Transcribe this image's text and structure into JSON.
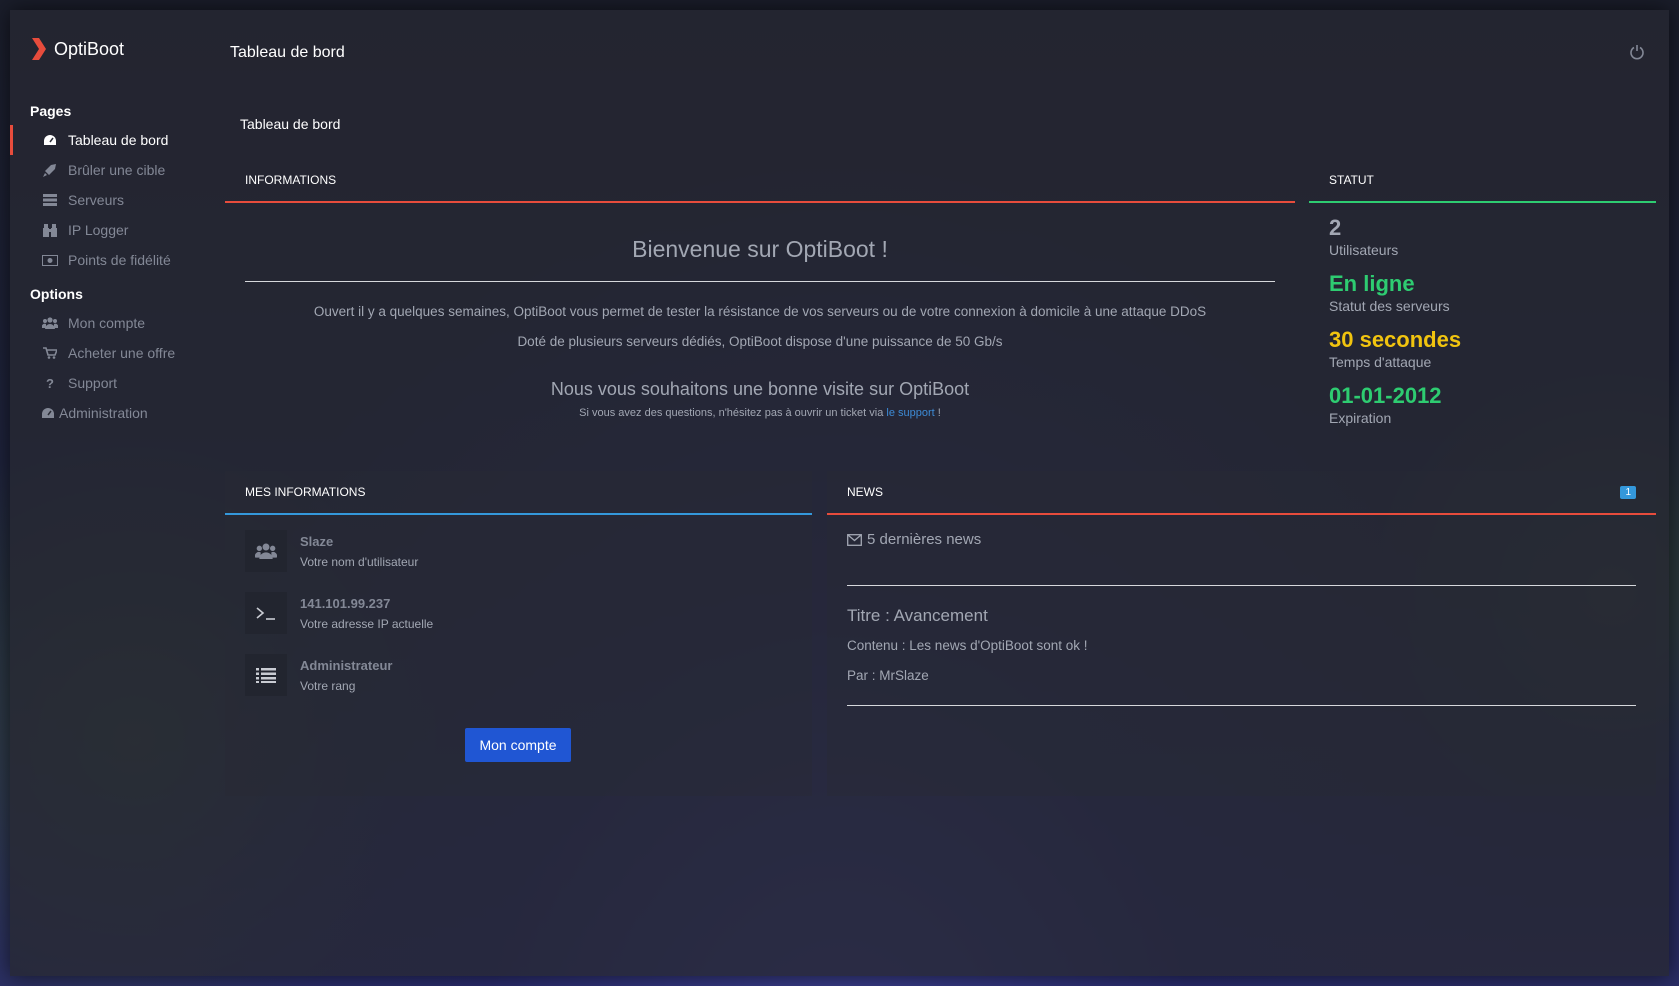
{
  "brand": {
    "name": "OptiBoot",
    "accent": "#e74c3c"
  },
  "topbar": {
    "title": "Tableau de bord",
    "power_icon": "power-icon"
  },
  "breadcrumb": "Tableau de bord",
  "sidebar": {
    "pages_heading": "Pages",
    "pages": [
      {
        "label": "Tableau de bord",
        "icon": "dashboard-icon",
        "active": true
      },
      {
        "label": "Brûler une cible",
        "icon": "rocket-icon"
      },
      {
        "label": "Serveurs",
        "icon": "server-icon"
      },
      {
        "label": "IP Logger",
        "icon": "binoculars-icon"
      },
      {
        "label": "Points de fidélité",
        "icon": "money-icon"
      }
    ],
    "options_heading": "Options",
    "options": [
      {
        "label": "Mon compte",
        "icon": "users-icon"
      },
      {
        "label": "Acheter une offre",
        "icon": "cart-icon"
      },
      {
        "label": "Support",
        "icon": "question-icon"
      },
      {
        "label": "Administration",
        "icon": "dashboard-icon"
      }
    ]
  },
  "informations": {
    "header": "INFORMATIONS",
    "welcome": "Bienvenue sur OptiBoot !",
    "line1": "Ouvert il y a quelques semaines, OptiBoot vous permet de tester la résistance de vos serveurs ou de votre connexion à domicile à une attaque DDoS",
    "line2": "Doté de plusieurs serveurs dédiés, OptiBoot dispose d'une puissance de 50 Gb/s",
    "wish": "Nous vous souhaitons une bonne visite sur OptiBoot",
    "help_prefix": "Si vous avez des questions, n'hésitez pas à ouvrir un ticket via ",
    "help_link": "le support",
    "help_suffix": " !"
  },
  "statut": {
    "header": "STATUT",
    "items": [
      {
        "value": "2",
        "label": "Utilisateurs",
        "color": "#a2a7b3"
      },
      {
        "value": "En ligne",
        "label": "Statut des serveurs",
        "color": "#2ecc71"
      },
      {
        "value": "30 secondes",
        "label": "Temps d'attaque",
        "color": "#f1c40f"
      },
      {
        "value": "01-01-2012",
        "label": "Expiration",
        "color": "#2ecc71"
      }
    ]
  },
  "mes_informations": {
    "header": "MES INFORMATIONS",
    "rows": [
      {
        "value": "Slaze",
        "label": "Votre nom d'utilisateur",
        "icon": "users-icon"
      },
      {
        "value": "141.101.99.237",
        "label": "Votre adresse IP actuelle",
        "icon": "terminal-icon"
      },
      {
        "value": "Administrateur",
        "label": "Votre rang",
        "icon": "list-icon"
      }
    ],
    "button": "Mon compte"
  },
  "news": {
    "header": "NEWS",
    "badge": "1",
    "count_label": "5 dernières news",
    "title": "Titre : Avancement",
    "content": "Contenu : Les news d'OptiBoot sont ok !",
    "author": "Par : MrSlaze"
  }
}
